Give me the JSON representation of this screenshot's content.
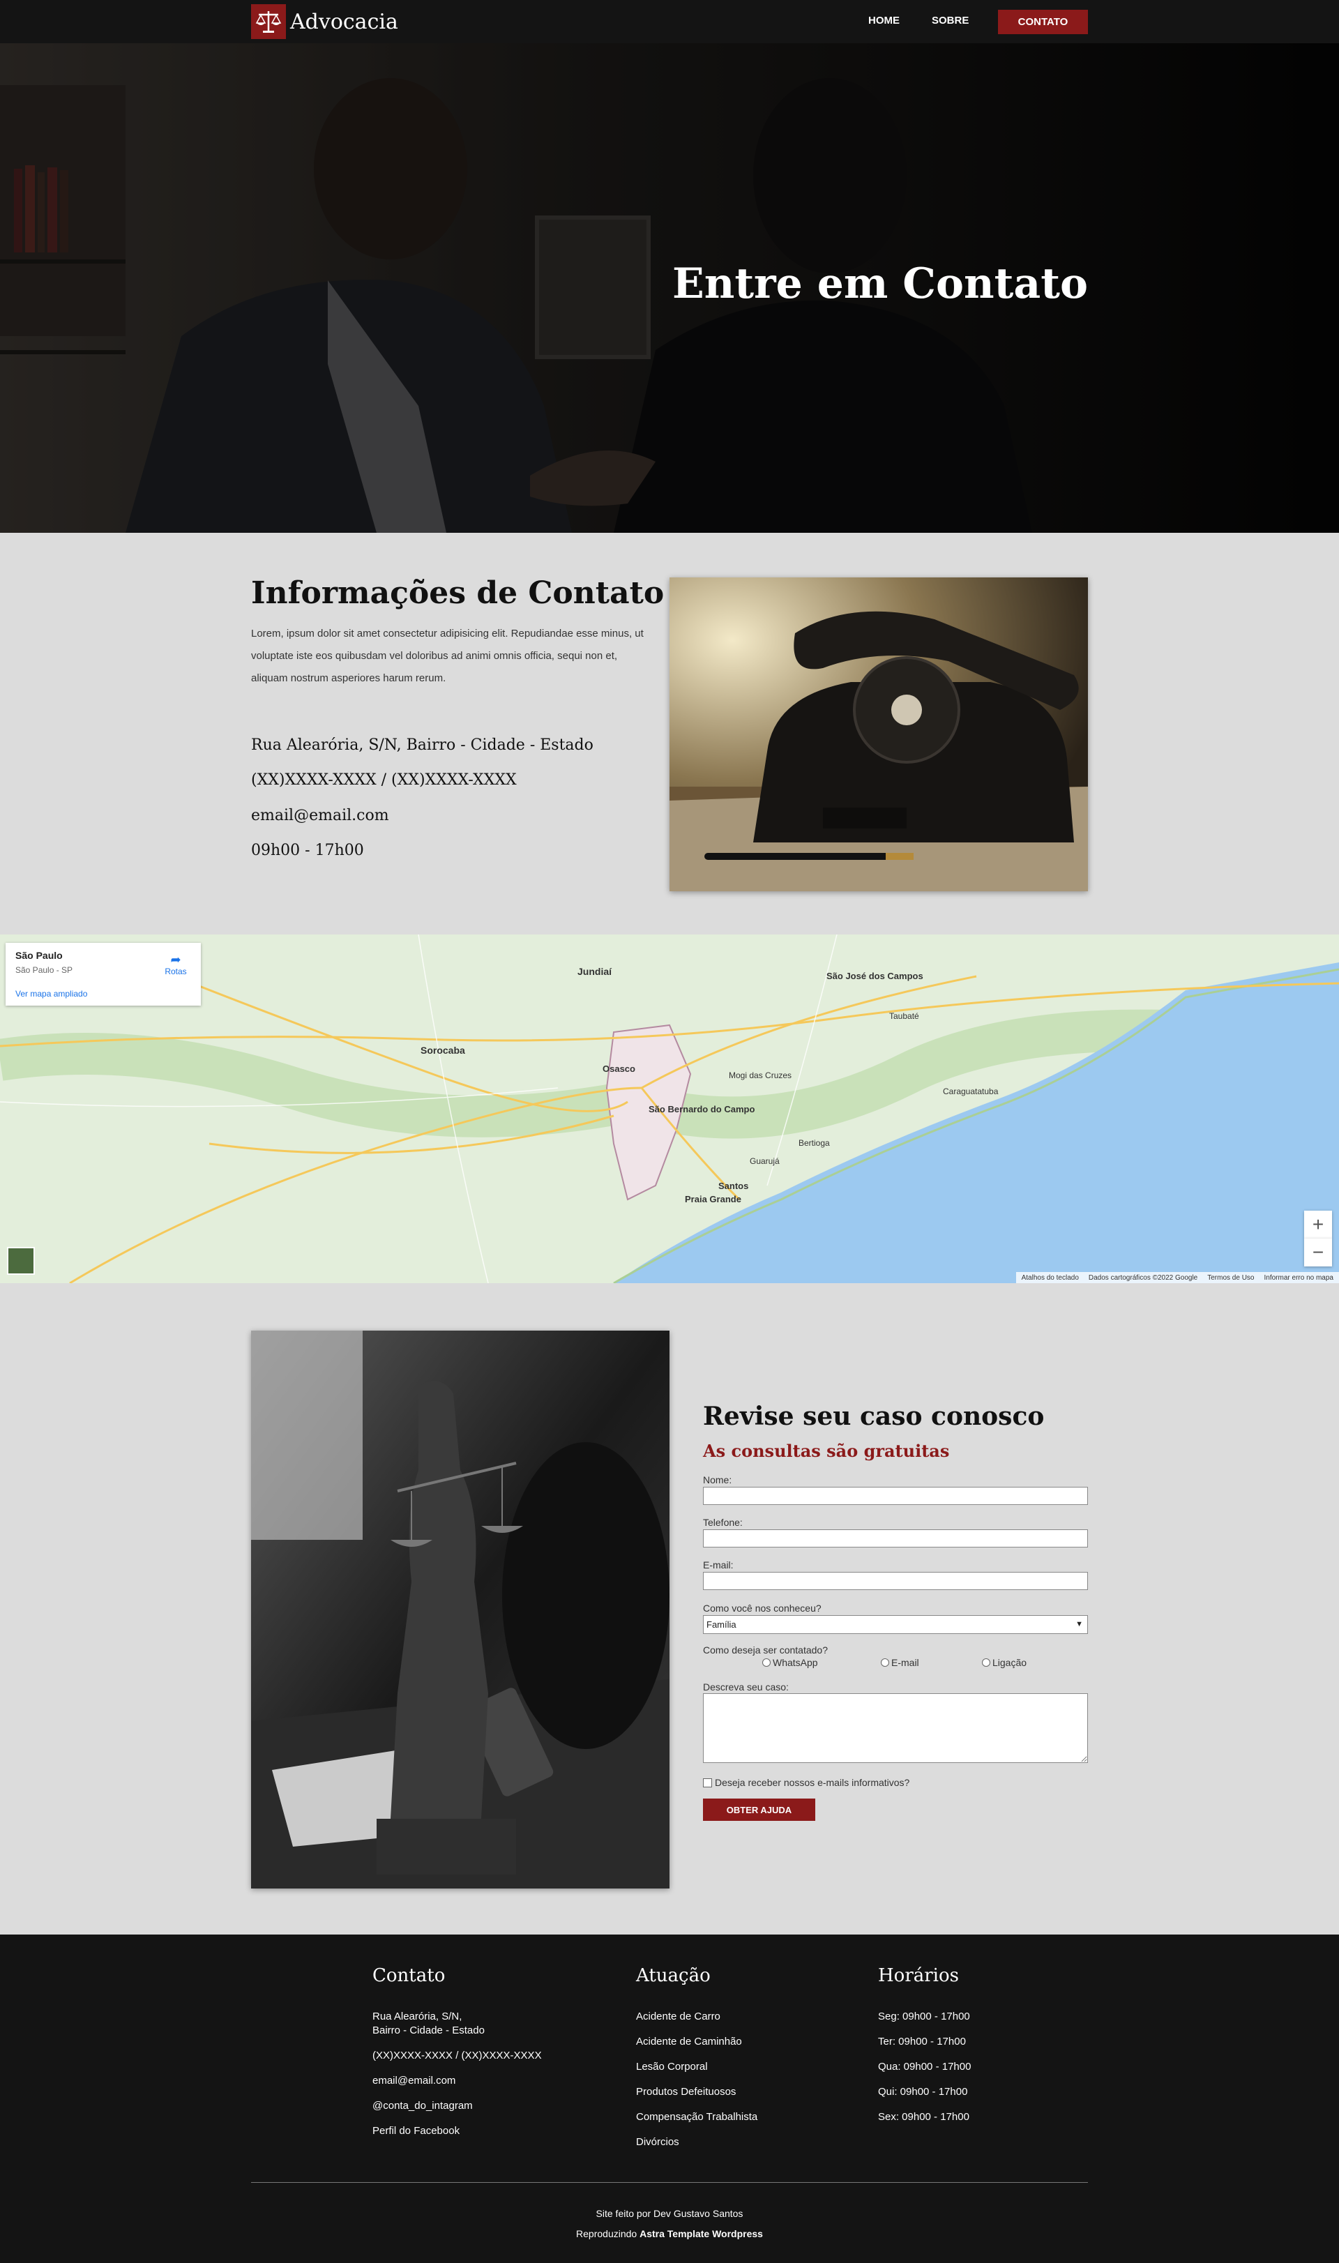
{
  "nav": {
    "brand": "Advocacia",
    "links": [
      "HOME",
      "SOBRE"
    ],
    "cta": "CONTATO"
  },
  "hero": {
    "title": "Entre em Contato"
  },
  "info": {
    "title": "Informações de Contato",
    "text": "Lorem, ipsum dolor sit amet consectetur adipisicing elit. Repudiandae esse minus, ut voluptate iste eos quibusdam vel doloribus ad animi omnis officia, sequi non et, aliquam nostrum asperiores harum rerum.",
    "address": "Rua Alearória, S/N, Bairro - Cidade - Estado",
    "phone": "(XX)XXXX-XXXX / (XX)XXXX-XXXX",
    "email": "email@email.com",
    "hours": "09h00 - 17h00"
  },
  "map": {
    "place": "São Paulo",
    "place_sub": "São Paulo - SP",
    "larger_map": "Ver mapa ampliado",
    "routes": "Rotas",
    "footer": [
      "Atalhos do teclado",
      "Dados cartográficos ©2022 Google",
      "Termos de Uso",
      "Informar erro no mapa"
    ],
    "labels": [
      {
        "text": "Jundiaí"
      },
      {
        "text": "São José dos Campos"
      },
      {
        "text": "Sorocaba"
      },
      {
        "text": "Osasco"
      },
      {
        "text": "São Bernardo do Campo"
      },
      {
        "text": "Santos"
      },
      {
        "text": "Praia Grande"
      },
      {
        "text": "Bertioga"
      },
      {
        "text": "Caraguatatuba"
      },
      {
        "text": "Guarujá"
      },
      {
        "text": "Taubaté"
      },
      {
        "text": "Mogi das Cruzes"
      }
    ]
  },
  "form": {
    "title": "Revise seu caso conosco",
    "subtitle": "As consultas são gratuitas",
    "name_label": "Nome:",
    "phone_label": "Telefone:",
    "email_label": "E-mail:",
    "source_label": "Como você nos conheceu?",
    "source_value": "Família",
    "contact_label": "Como deseja ser contatado?",
    "contact_options": [
      "WhatsApp",
      "E-mail",
      "Ligação"
    ],
    "case_label": "Descreva seu caso:",
    "newsletter": "Deseja receber nossos e-mails informativos?",
    "submit": "OBTER AJUDA"
  },
  "footer": {
    "contact_title": "Contato",
    "contact_address_1": "Rua Alearória, S/N,",
    "contact_address_2": "Bairro - Cidade - Estado",
    "contact_phone": "(XX)XXXX-XXXX / (XX)XXXX-XXXX",
    "contact_email": "email@email.com",
    "contact_instagram": "@conta_do_intagram",
    "contact_facebook": "Perfil do Facebook",
    "areas_title": "Atuação",
    "areas": [
      "Acidente de Carro",
      "Acidente de Caminhão",
      "Lesão Corporal",
      "Produtos Defeituosos",
      "Compensação Trabalhista",
      "Divórcios"
    ],
    "hours_title": "Horários",
    "hours": [
      "Seg: 09h00 - 17h00",
      "Ter: 09h00 - 17h00",
      "Qua: 09h00 - 17h00",
      "Qui: 09h00 - 17h00",
      "Sex: 09h00 - 17h00"
    ],
    "credit_1": "Site feito por Dev Gustavo Santos",
    "credit_2_prefix": "Reproduzindo",
    "credit_2_bold": "Astra Template Wordpress"
  },
  "colors": {
    "brand": "#8b1a1a",
    "dark": "#141414",
    "page": "#dcdcdc"
  }
}
